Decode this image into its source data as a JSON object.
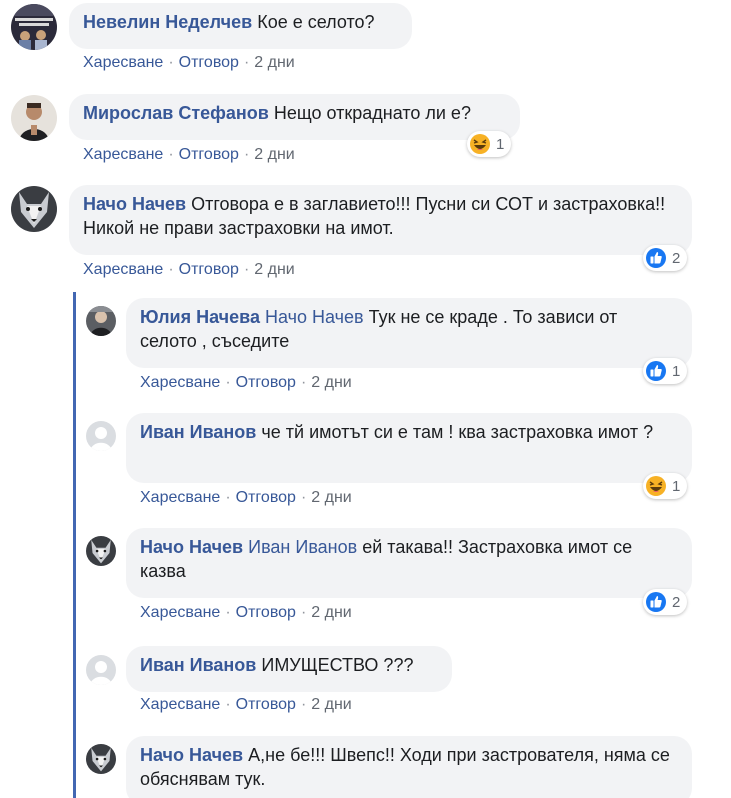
{
  "comments": [
    {
      "author": "Невелин Неделчев",
      "mention": "",
      "text": "Кое е селото?",
      "like": "Харесване",
      "reply": "Отговор",
      "sep": "·",
      "time": "2 дни"
    },
    {
      "author": "Мирослав Стефанов",
      "mention": "",
      "text": "Нещо откраднато ли е?",
      "like": "Харесване",
      "reply": "Отговор",
      "sep": "·",
      "time": "2 дни",
      "reaction": {
        "icon": "haha-reaction-icon",
        "count": "1"
      }
    },
    {
      "author": "Начо Начев",
      "mention": "",
      "text": "Отговора е в заглавието!!! Пусни си СОТ и застраховка!! Никой не прави застраховки на имот.",
      "like": "Харесване",
      "reply": "Отговор",
      "sep": "·",
      "time": "2 дни",
      "reaction": {
        "icon": "like-reaction-icon",
        "count": "2"
      }
    }
  ],
  "replies": [
    {
      "author": "Юлия Начева",
      "mention": "Начо Начев",
      "text": "Тук не се краде . То зависи от селото , съседите",
      "like": "Харесване",
      "reply": "Отговор",
      "sep": "·",
      "time": "2 дни",
      "reaction": {
        "icon": "like-reaction-icon",
        "count": "1"
      }
    },
    {
      "author": "Иван Иванов",
      "mention": "",
      "text": "че тй имотът си е там ! ква застраховка имот ?",
      "like": "Харесване",
      "reply": "Отговор",
      "sep": "·",
      "time": "2 дни",
      "reaction": {
        "icon": "haha-reaction-icon",
        "count": "1"
      }
    },
    {
      "author": "Начо Начев",
      "mention": "Иван Иванов",
      "text": "ей такава!! Застраховка имот се казва",
      "like": "Харесване",
      "reply": "Отговор",
      "sep": "·",
      "time": "2 дни",
      "reaction": {
        "icon": "like-reaction-icon",
        "count": "2"
      }
    },
    {
      "author": "Иван Иванов",
      "mention": "",
      "text": "ИМУЩЕСТВО ???",
      "like": "Харесване",
      "reply": "Отговор",
      "sep": "·",
      "time": "2 дни"
    },
    {
      "author": "Начо Начев",
      "mention": "",
      "text": "А,не бе!!! Швепс!! Ходи при застрователя, няма се обяснявам тук.",
      "like": "",
      "reply": "",
      "sep": "",
      "time": ""
    }
  ],
  "colors": {
    "link": "#385898",
    "bubble": "#f2f3f5",
    "thread": "#4267b2",
    "like": "#1877f2",
    "haha": "#f7b125"
  }
}
